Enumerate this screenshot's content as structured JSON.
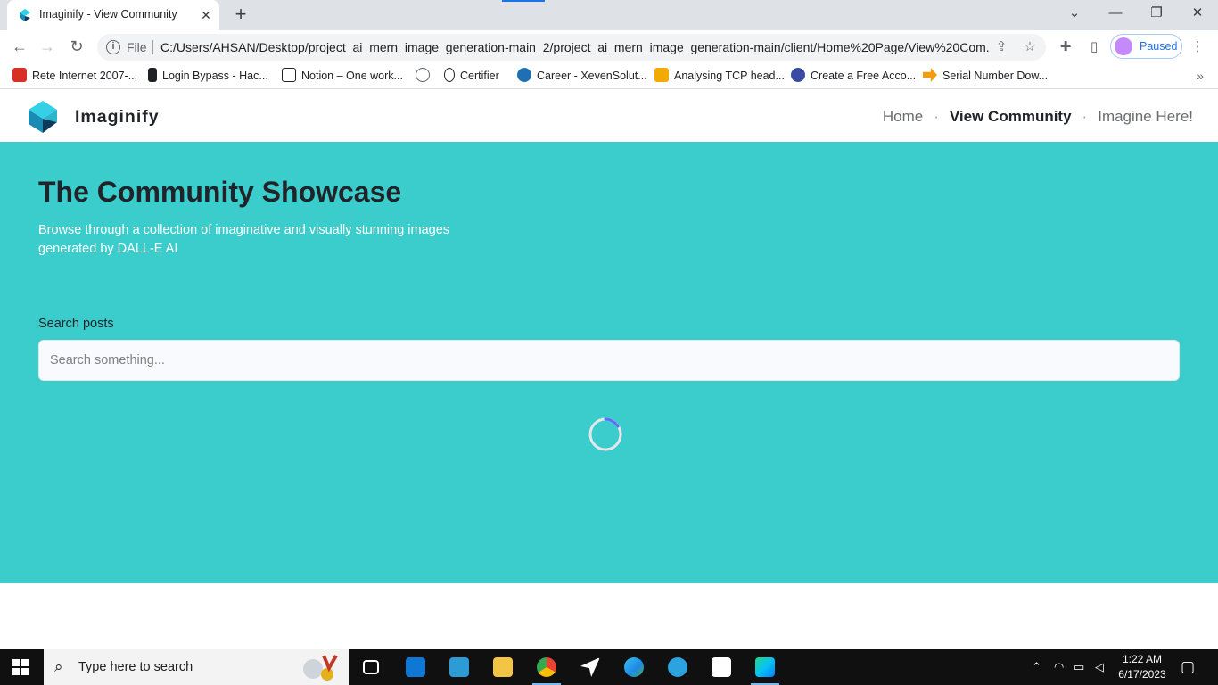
{
  "browser": {
    "tab": {
      "title": "Imaginify - View Community"
    },
    "omnibox": {
      "scheme": "File",
      "url": "C:/Users/AHSAN/Desktop/project_ai_mern_image_generation-main_2/project_ai_mern_image_generation-main/client/Home%20Page/View%20Com..."
    },
    "profile": {
      "label": "Paused"
    },
    "bookmarks": [
      {
        "label": "Rete Internet 2007-...",
        "color": "#d93025"
      },
      {
        "label": "Login Bypass - Hac...",
        "color": "#202124"
      },
      {
        "label": "Notion – One work...",
        "color": "#202124"
      },
      {
        "label": "",
        "color": "#5f6368"
      },
      {
        "label": "Certifier",
        "color": "#202124"
      },
      {
        "label": "Career - XevenSolut...",
        "color": "#1f6fb2"
      },
      {
        "label": "Analysing TCP head...",
        "color": "#f2a900"
      },
      {
        "label": "Create a Free Acco...",
        "color": "#3b4aa3"
      },
      {
        "label": "Serial Number Dow...",
        "color": "#f39c12"
      }
    ]
  },
  "site": {
    "brand": "Imaginify",
    "nav": {
      "home": "Home",
      "community": "View Community",
      "imagine": "Imagine Here!",
      "separator": "·"
    },
    "accent_color": "#3acdcc"
  },
  "main": {
    "heading": "The Community Showcase",
    "subtitle": "Browse through a collection of imaginative and visually stunning images generated by DALL-E AI",
    "search": {
      "label": "Search posts",
      "placeholder": "Search something...",
      "value": ""
    },
    "loading": true
  },
  "taskbar": {
    "search_placeholder": "Type here to search",
    "apps": [
      "task-view",
      "mail",
      "azure-data-studio",
      "file-explorer",
      "chrome",
      "arrow-app",
      "edge",
      "telegram",
      "microsoft-store",
      "webstorm"
    ],
    "clock": {
      "time": "1:22 AM",
      "date": "6/17/2023"
    }
  }
}
